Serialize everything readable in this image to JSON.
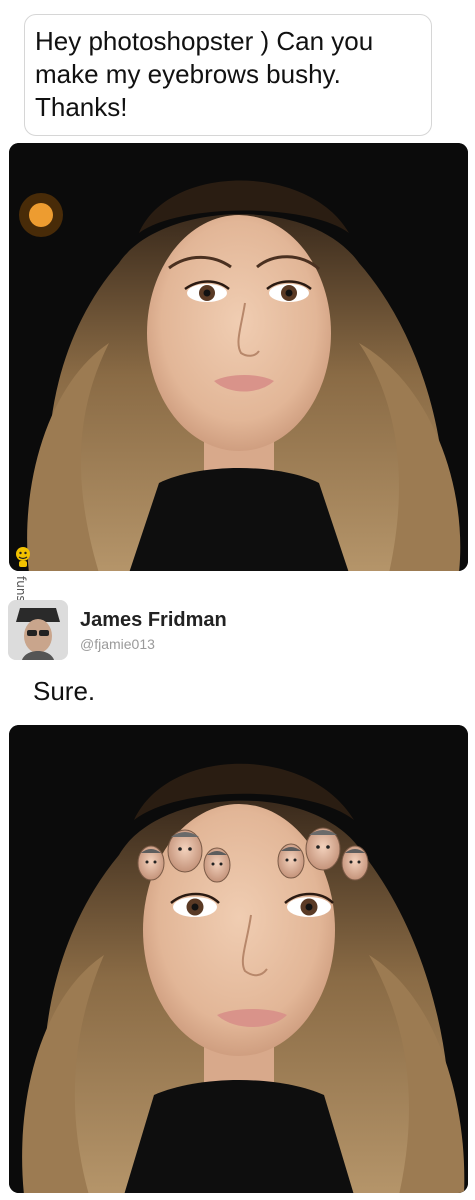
{
  "request": {
    "line1": "Hey photoshopster ) Can you",
    "line2": "make my eyebrows bushy.",
    "line3": "Thanks!"
  },
  "photos": {
    "before_alt": "Original photo",
    "after_alt": "Edited photo"
  },
  "watermark": {
    "text": "funssy.com",
    "icon": "mascot-icon"
  },
  "reply": {
    "author_name": "James Fridman",
    "author_handle": "@fjamie013",
    "message": "Sure."
  },
  "colors": {
    "bubble_border": "#d6d6d6",
    "text": "#111111",
    "handle": "#9a9a9a",
    "hair": "#8a6b45",
    "skin": "#e8c1a4",
    "background_dark": "#0b0b0b"
  }
}
